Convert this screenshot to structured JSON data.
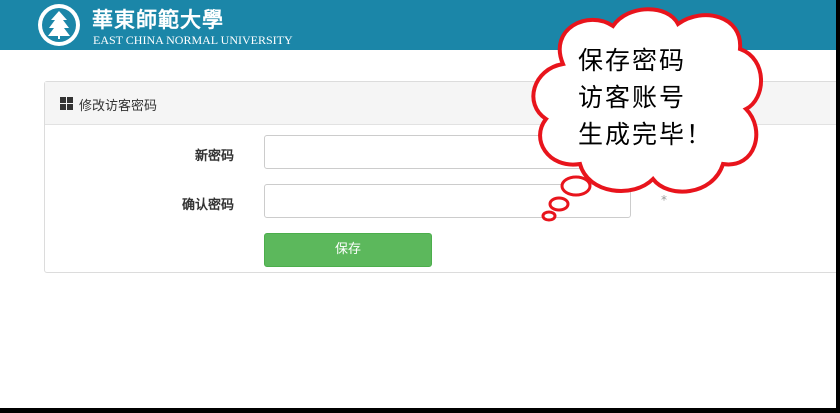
{
  "header": {
    "logo_cn": "華東師範大學",
    "logo_en": "EAST CHINA NORMAL UNIVERSITY",
    "background_color": "#1b86a8"
  },
  "panel": {
    "title": "修改访客密码",
    "title_icon": "grid-icon",
    "fields": [
      {
        "label": "新密码",
        "value": "",
        "required_mark": "*"
      },
      {
        "label": "确认密码",
        "value": "",
        "required_mark": "*"
      }
    ],
    "save_label": "保存",
    "save_color": "#5cb85c"
  },
  "annotation": {
    "lines": [
      "保存密码",
      "访客账号",
      "生成完毕！"
    ],
    "outline_color": "#e8141c"
  }
}
